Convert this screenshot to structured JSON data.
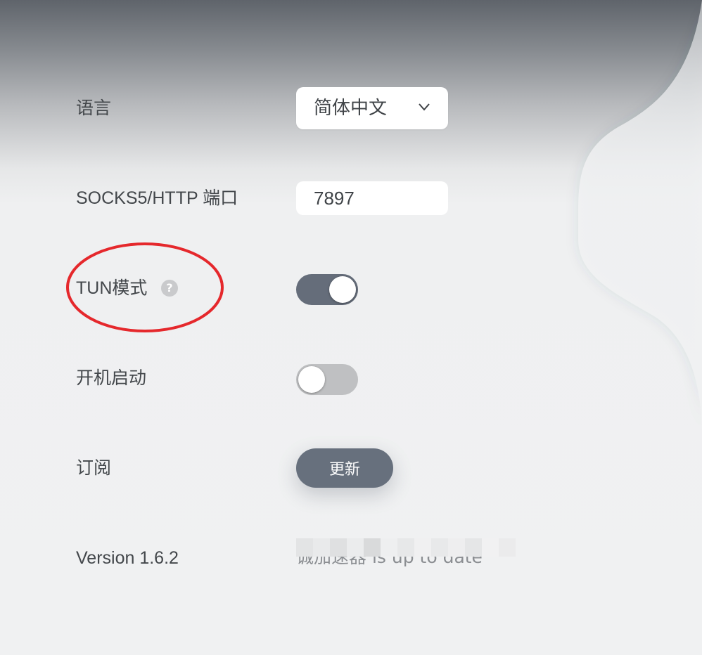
{
  "settings": {
    "language": {
      "label": "语言",
      "selected": "简体中文",
      "icon": "chevron-down-icon"
    },
    "port": {
      "label": "SOCKS5/HTTP 端口",
      "value": "7897"
    },
    "tun": {
      "label": "TUN模式",
      "help_glyph": "?",
      "enabled": true
    },
    "autostart": {
      "label": "开机启动",
      "enabled": false
    },
    "subscription": {
      "label": "订阅",
      "button_label": "更新"
    },
    "version": {
      "label": "Version 1.6.2",
      "status": "诚加速器 is up to date"
    }
  },
  "colors": {
    "toggle_on": "#656d7a",
    "toggle_off": "#bfc0c2",
    "button": "#67707d",
    "annotation": "#e5282c"
  }
}
